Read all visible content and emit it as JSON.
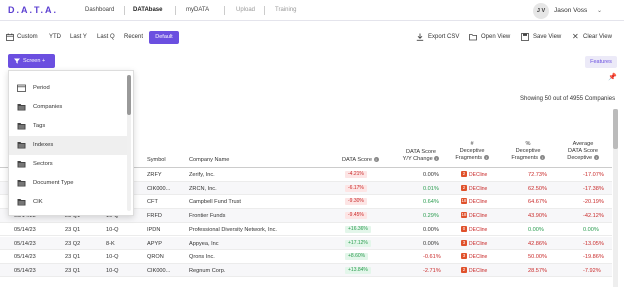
{
  "nav": {
    "logo": "D.A.T.A.",
    "links": [
      "Dashboard",
      "DATAbase",
      "myDATA",
      "Upload",
      "Training"
    ],
    "user_initials": "J V",
    "user_name": "Jason Voss"
  },
  "toolbar": {
    "filters": [
      "Custom",
      "YTD",
      "Last Y",
      "Last Q",
      "Recent",
      "Default"
    ],
    "export_label": "Export CSV",
    "open_view_label": "Open View",
    "save_view_label": "Save View",
    "clear_view_label": "Clear View"
  },
  "screen_button": "Screen +",
  "features_button": "Features",
  "showing_text": "Showing 50 out of 4955 Companies",
  "dropdown": {
    "items": [
      "Period",
      "Companies",
      "Tags",
      "Indexes",
      "Sectors",
      "Document Type",
      "CIK"
    ]
  },
  "table": {
    "headers": {
      "symbol": "Symbol",
      "company": "Company Name",
      "data_score": "DATA Score",
      "yy_change": [
        "DATA Score",
        "Y/Y Change"
      ],
      "deceptive_frag": [
        "#",
        "Deceptive",
        "Fragments"
      ],
      "pct_deceptive": [
        "%",
        "Deceptive",
        "Fragments"
      ],
      "avg_score": [
        "Average",
        "DATA Score",
        "Deceptive"
      ]
    },
    "decline_label": "DECline",
    "rows": [
      {
        "date": "",
        "qtr": "",
        "form": "",
        "symbol": "ZRFY",
        "company": "Zerify, Inc.",
        "score": "-4.21%",
        "yy": "0.00%",
        "frag": "2",
        "pct": "72.73%",
        "avg": "-17.07%"
      },
      {
        "date": "",
        "qtr": "",
        "form": "",
        "symbol": "CIK000...",
        "company": "ZRCN, Inc.",
        "score": "-6.17%",
        "yy": "0.01%",
        "frag": "2",
        "pct": "62.50%",
        "avg": "-17.38%"
      },
      {
        "date": "",
        "qtr": "",
        "form": "",
        "symbol": "CFT",
        "company": "Campbell Fund Trust",
        "score": "-9.30%",
        "yy": "0.64%",
        "frag": "18",
        "pct": "64.67%",
        "avg": "-20.19%"
      },
      {
        "date": "05/14/23",
        "qtr": "23 Q1",
        "form": "10-Q",
        "symbol": "FRFD",
        "company": "Frontier Funds",
        "score": "-9.45%",
        "yy": "0.29%",
        "frag": "18",
        "pct": "43.90%",
        "avg": "-42.12%"
      },
      {
        "date": "05/14/23",
        "qtr": "23 Q1",
        "form": "10-Q",
        "symbol": "IPDN",
        "company": "Professional Diversity Network, Inc.",
        "score": "+16.36%",
        "yy": "0.00%",
        "frag": "0",
        "pct": "0.00%",
        "avg": "0.00%"
      },
      {
        "date": "05/14/23",
        "qtr": "23 Q2",
        "form": "8-K",
        "symbol": "APYP",
        "company": "Appyea, Inc",
        "score": "+17.12%",
        "yy": "0.00%",
        "frag": "3",
        "pct": "42.86%",
        "avg": "-13.05%"
      },
      {
        "date": "05/14/23",
        "qtr": "23 Q1",
        "form": "10-Q",
        "symbol": "QRON",
        "company": "Qrons Inc.",
        "score": "+8.60%",
        "yy": "-0.61%",
        "frag": "3",
        "pct": "50.00%",
        "avg": "-19.86%"
      },
      {
        "date": "05/14/23",
        "qtr": "23 Q1",
        "form": "10-Q",
        "symbol": "CIK000...",
        "company": "Regnum Corp.",
        "score": "+13.84%",
        "yy": "-2.71%",
        "frag": "2",
        "pct": "28.57%",
        "avg": "-7.92%"
      }
    ]
  },
  "colors": {
    "accent": "#6b4fe0",
    "negative": "#c92a2a",
    "positive": "#2a9c4f"
  }
}
